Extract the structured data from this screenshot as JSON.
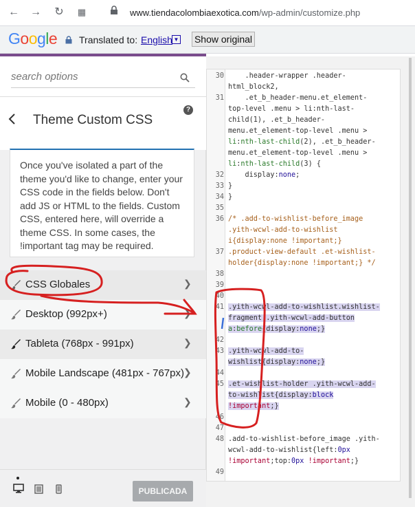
{
  "browser": {
    "url_domain": "www.tiendacolombiaexotica.com",
    "url_path": "/wp-admin/customize.php"
  },
  "translate_bar": {
    "logo": "Google",
    "translated_label": "Translated to:",
    "language": "English",
    "show_original": "Show original"
  },
  "panel": {
    "search_placeholder": "search options",
    "section_title": "Theme Custom CSS",
    "description": "Once you've isolated a part of the theme you'd like to change, enter your CSS code in the fields below. Don't add JS or HTML to the fields. Custom CSS, entered here, will override a theme CSS. In some cases, the !important tag may be required.",
    "items": [
      {
        "label": "CSS Globales"
      },
      {
        "label": "Desktop (992px+)"
      },
      {
        "label": "Tableta (768px - 991px)"
      },
      {
        "label": "Mobile Landscape (481px - 767px)"
      },
      {
        "label": "Mobile (0 - 480px)"
      }
    ],
    "publish_label": "PUBLICADA"
  },
  "editor": {
    "lines": [
      {
        "n": "30",
        "text": "    .header-wrapper .header-"
      },
      {
        "n": "",
        "text": "html_block2,"
      },
      {
        "n": "31",
        "text": "    .et_b_header-menu.et_element-"
      },
      {
        "n": "",
        "text": "top-level .menu > li:nth-last-"
      },
      {
        "n": "",
        "text": "child(1), .et_b_header-"
      },
      {
        "n": "",
        "text": "menu.et_element-top-level .menu >"
      },
      {
        "n": "",
        "text": "li:nth-last-child(2), .et_b_header-"
      },
      {
        "n": "",
        "text": "menu.et_element-top-level .menu >"
      },
      {
        "n": "",
        "text": "li:nth-last-child(3) {"
      },
      {
        "n": "32",
        "text": "    display: none;"
      },
      {
        "n": "33",
        "text": "}"
      },
      {
        "n": "34",
        "text": "}"
      },
      {
        "n": "35",
        "text": ""
      },
      {
        "n": "36",
        "text": "/* .add-to-wishlist-before_image"
      },
      {
        "n": "",
        "text": ".yith-wcwl-add-to-wishlist"
      },
      {
        "n": "",
        "text": "i{display:none !important;}"
      },
      {
        "n": "37",
        "text": ".product-view-default .et-wishlist-"
      },
      {
        "n": "",
        "text": "holder{display:none !important;} */"
      },
      {
        "n": "38",
        "text": ""
      },
      {
        "n": "39",
        "text": ""
      },
      {
        "n": "40",
        "text": ""
      },
      {
        "n": "41",
        "text": ".yith-wcwl-add-to-wishlist.wishlist-"
      },
      {
        "n": "",
        "text": "fragment .yith-wcwl-add-button"
      },
      {
        "n": "",
        "text": "a:before{display:none;}"
      },
      {
        "n": "42",
        "text": ""
      },
      {
        "n": "43",
        "text": ".yith-wcwl-add-to-"
      },
      {
        "n": "",
        "text": "wishlist{display:none;}"
      },
      {
        "n": "44",
        "text": ""
      },
      {
        "n": "45",
        "text": ".et-wishlist-holder .yith-wcwl-add-"
      },
      {
        "n": "",
        "text": "to-wishlist{display:block"
      },
      {
        "n": "",
        "text": "!important;}"
      },
      {
        "n": "46",
        "text": ""
      },
      {
        "n": "47",
        "text": ""
      },
      {
        "n": "48",
        "text": ".add-to-wishlist-before_image .yith-"
      },
      {
        "n": "",
        "text": "wcwl-add-to-wishlist{left:0px"
      },
      {
        "n": "",
        "text": "!important;top:0px !important;}"
      },
      {
        "n": "49",
        "text": ""
      }
    ]
  },
  "colors": {
    "accent": "#2271b1",
    "annotation_red": "#d62020",
    "selection": "#d9d5f0"
  }
}
